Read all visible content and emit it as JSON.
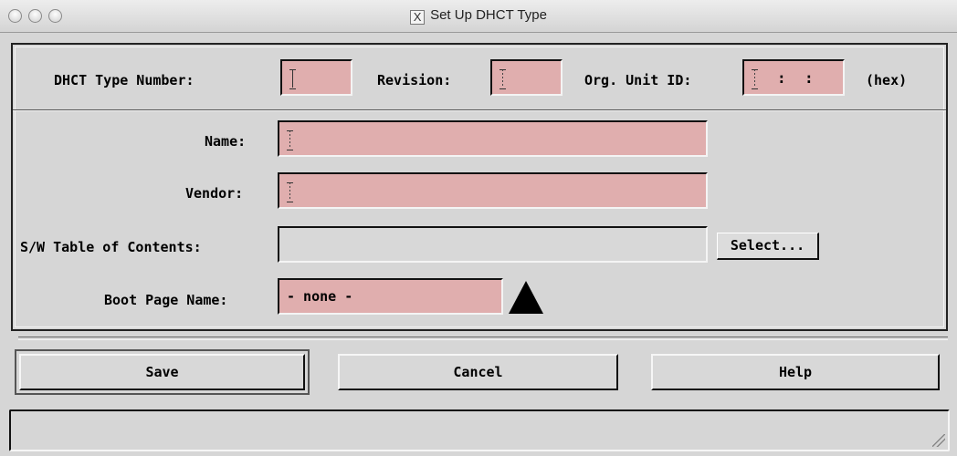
{
  "window": {
    "title": "Set Up DHCT Type",
    "title_icon": "x11-icon"
  },
  "ids": {
    "type_number_label": "DHCT Type Number:",
    "revision_label": "Revision:",
    "org_unit_label": "Org. Unit ID:",
    "hex_label": "(hex)",
    "type_number_value": "",
    "revision_value": "",
    "org_unit_value": ""
  },
  "form": {
    "name_label": "Name:",
    "name_value": "",
    "vendor_label": "Vendor:",
    "vendor_value": "",
    "sw_toc_label": "S/W Table of Contents:",
    "sw_toc_value": "",
    "select_button": "Select...",
    "boot_page_label": "Boot Page Name:",
    "boot_page_value": "- none -"
  },
  "buttons": {
    "save": "Save",
    "cancel": "Cancel",
    "help": "Help"
  },
  "status_text": "",
  "colors": {
    "required_field": "#e0aeae",
    "background": "#d6d6d6"
  }
}
